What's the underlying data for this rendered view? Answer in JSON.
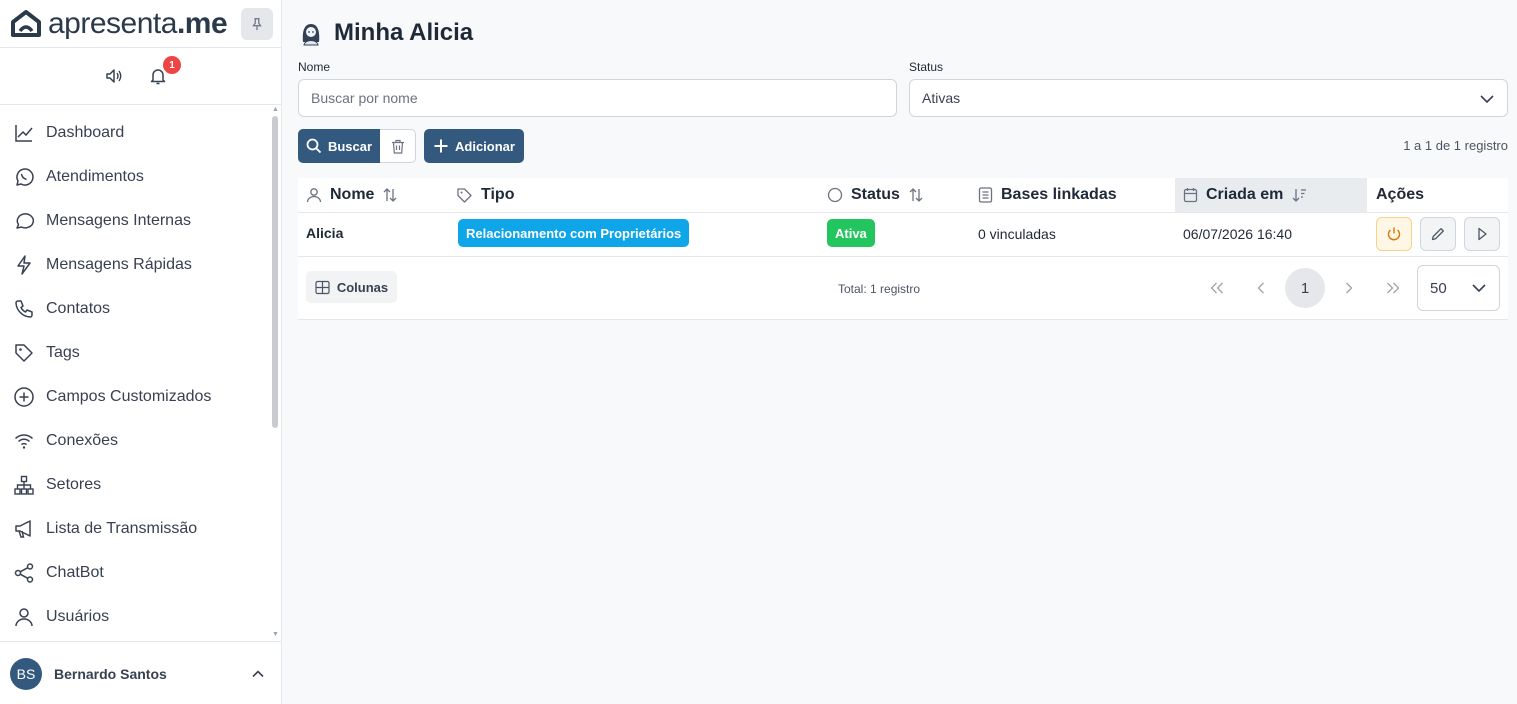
{
  "brand": {
    "name_prefix": "apresenta",
    "name_suffix": ".me"
  },
  "notifications": {
    "count": "1"
  },
  "sidebar": {
    "items": [
      {
        "label": "Dashboard",
        "icon": "chart-line-icon"
      },
      {
        "label": "Atendimentos",
        "icon": "whatsapp-icon"
      },
      {
        "label": "Mensagens Internas",
        "icon": "chat-bubble-icon"
      },
      {
        "label": "Mensagens Rápidas",
        "icon": "bolt-icon"
      },
      {
        "label": "Contatos",
        "icon": "phone-icon"
      },
      {
        "label": "Tags",
        "icon": "tag-icon"
      },
      {
        "label": "Campos Customizados",
        "icon": "plus-circle-icon"
      },
      {
        "label": "Conexões",
        "icon": "wifi-icon"
      },
      {
        "label": "Setores",
        "icon": "sitemap-icon"
      },
      {
        "label": "Lista de Transmissão",
        "icon": "megaphone-icon"
      },
      {
        "label": "ChatBot",
        "icon": "share-icon"
      },
      {
        "label": "Usuários",
        "icon": "user-icon"
      }
    ]
  },
  "user": {
    "initials": "BS",
    "name": "Bernardo Santos"
  },
  "page": {
    "title": "Minha Alicia"
  },
  "filters": {
    "name_label": "Nome",
    "name_placeholder": "Buscar por nome",
    "status_label": "Status",
    "status_value": "Ativas"
  },
  "actions": {
    "search_label": "Buscar",
    "add_label": "Adicionar"
  },
  "record_range": "1 a 1 de 1 registro",
  "table": {
    "headers": {
      "name": "Nome",
      "type": "Tipo",
      "status": "Status",
      "bases": "Bases linkadas",
      "created": "Criada em",
      "actions": "Ações"
    },
    "rows": [
      {
        "name": "Alicia",
        "type": "Relacionamento com Proprietários",
        "status": "Ativa",
        "bases": "0 vinculadas",
        "created": "06/07/2026 16:40"
      }
    ]
  },
  "footer": {
    "columns_label": "Colunas",
    "total": "Total: 1 registro",
    "current_page": "1",
    "per_page": "50"
  },
  "colors": {
    "primary": "#34597f",
    "type_tag": "#0ea5e9",
    "status_active": "#22c55e",
    "badge": "#ef4444"
  }
}
